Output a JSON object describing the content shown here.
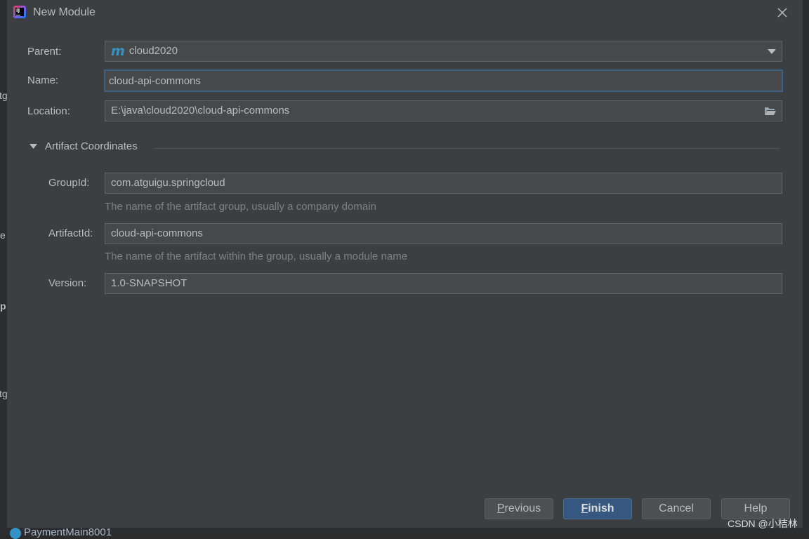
{
  "background": {
    "left_fragments": [
      "tg",
      "e",
      "p",
      "tg"
    ],
    "bottom_tab": "PaymentMain8001"
  },
  "dialog": {
    "title": "New Module",
    "parent": {
      "label": "Parent:",
      "value": "cloud2020",
      "icon": "maven-m-icon"
    },
    "name": {
      "label": "Name:",
      "value": "cloud-api-commons"
    },
    "location": {
      "label": "Location:",
      "value": "E:\\java\\cloud2020\\cloud-api-commons"
    },
    "artifact_section": {
      "title": "Artifact Coordinates",
      "expanded": true,
      "group_id": {
        "label": "GroupId:",
        "value": "com.atguigu.springcloud",
        "hint": "The name of the artifact group, usually a company domain"
      },
      "artifact_id": {
        "label": "ArtifactId:",
        "value": "cloud-api-commons",
        "hint": "The name of the artifact within the group, usually a module name"
      },
      "version": {
        "label": "Version:",
        "value": "1.0-SNAPSHOT"
      }
    },
    "buttons": {
      "previous": {
        "mnemonic": "P",
        "rest": "revious"
      },
      "finish": {
        "mnemonic": "F",
        "rest": "inish"
      },
      "cancel": "Cancel",
      "help": "Help"
    }
  },
  "watermark": "CSDN @小桔林",
  "colors": {
    "dialog_bg": "#3c3f41",
    "field_bg": "#45494a",
    "focus_border": "#3d6185",
    "primary_button": "#365880",
    "maven_icon": "#3592c4"
  }
}
